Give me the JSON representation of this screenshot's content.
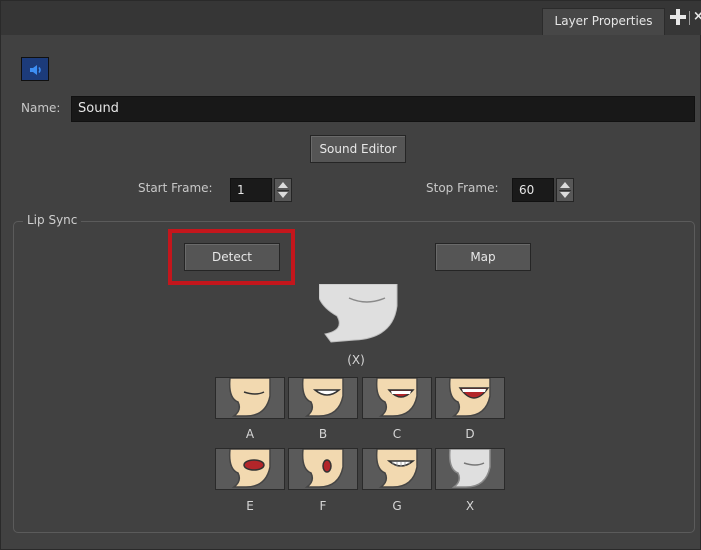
{
  "window": {
    "tab_title": "Layer Properties",
    "plus_icon": "plus-icon",
    "close_icon": "close-icon",
    "close_glyph": "×"
  },
  "layer": {
    "type_icon": "speaker-icon",
    "name_label": "Name:",
    "name_value": "Sound"
  },
  "sound_editor_label": "Sound Editor",
  "start_frame": {
    "label": "Start Frame:",
    "value": "1"
  },
  "stop_frame": {
    "label": "Stop Frame:",
    "value": "60"
  },
  "lip_sync": {
    "title": "Lip Sync",
    "detect_label": "Detect",
    "map_label": "Map",
    "current_shape_label": "(X)",
    "mouth_shapes": [
      "A",
      "B",
      "C",
      "D",
      "E",
      "F",
      "G",
      "X"
    ]
  },
  "colors": {
    "panel_bg": "#414141",
    "highlight": "#c4161c",
    "icon_bg": "#1c3b7a"
  }
}
